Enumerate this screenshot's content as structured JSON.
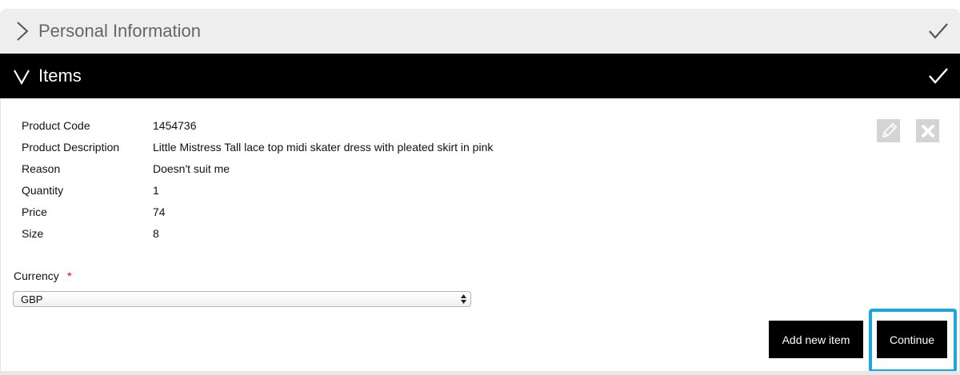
{
  "sections": {
    "personal": {
      "title": "Personal Information",
      "expanded": false,
      "complete": true,
      "chevron_icon": "chevron-right-icon",
      "check_icon": "checkmark-icon"
    },
    "items": {
      "title": "Items",
      "expanded": true,
      "complete": true,
      "chevron_icon": "chevron-down-icon",
      "check_icon": "checkmark-icon"
    }
  },
  "item": {
    "fields": [
      {
        "label": "Product Code",
        "value": "1454736"
      },
      {
        "label": "Product Description",
        "value": "Little Mistress Tall lace top midi skater dress with pleated skirt in pink"
      },
      {
        "label": "Reason",
        "value": "Doesn't suit me"
      },
      {
        "label": "Quantity",
        "value": "1"
      },
      {
        "label": "Price",
        "value": "74"
      },
      {
        "label": "Size",
        "value": "8"
      }
    ],
    "edit_icon": "pencil-icon",
    "remove_icon": "close-icon"
  },
  "currency": {
    "label": "Currency",
    "required_marker": "*",
    "selected": "GBP"
  },
  "actions": {
    "add_new_item": "Add new item",
    "continue": "Continue"
  },
  "colors": {
    "active_header_bg": "#000000",
    "inactive_header_bg": "#eeeeee",
    "button_bg": "#000000",
    "highlight": "#1aa7e0",
    "required": "#d0021b"
  }
}
